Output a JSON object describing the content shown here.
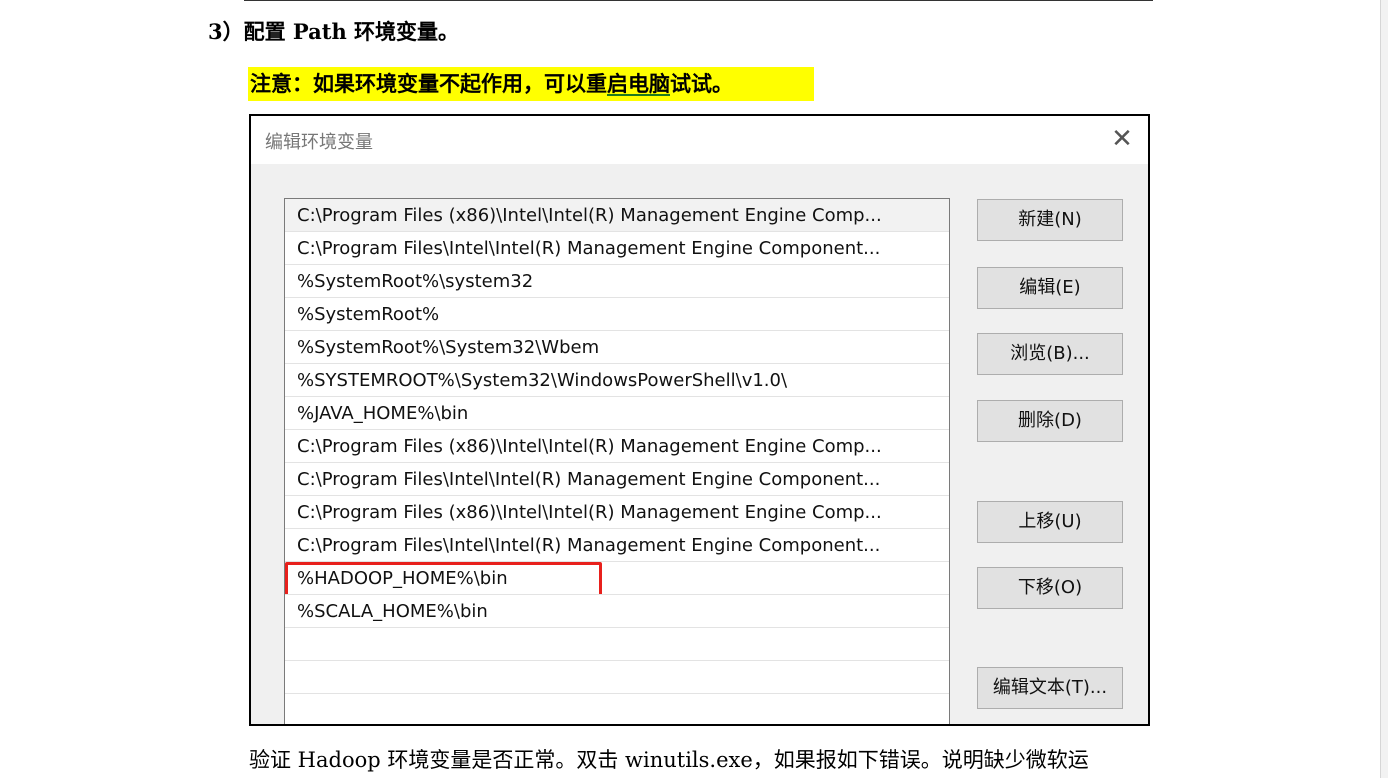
{
  "document": {
    "heading": "3）配置 Path 环境变量。",
    "note": {
      "prefix": "注意：如果环境变量不起作用，可以重",
      "underlined": "启电脑",
      "suffix": "试试。"
    },
    "paragraph": "验证 Hadoop 环境变量是否正常。双击 winutils.exe，如果报如下错误。说明缺少微软运"
  },
  "dialog": {
    "title": "编辑环境变量",
    "close_symbol": "✕",
    "entries": [
      "C:\\Program Files (x86)\\Intel\\Intel(R) Management Engine Comp...",
      "C:\\Program Files\\Intel\\Intel(R) Management Engine Component...",
      "%SystemRoot%\\system32",
      "%SystemRoot%",
      "%SystemRoot%\\System32\\Wbem",
      "%SYSTEMROOT%\\System32\\WindowsPowerShell\\v1.0\\",
      "%JAVA_HOME%\\bin",
      "C:\\Program Files (x86)\\Intel\\Intel(R) Management Engine Comp...",
      "C:\\Program Files\\Intel\\Intel(R) Management Engine Component...",
      "C:\\Program Files (x86)\\Intel\\Intel(R) Management Engine Comp...",
      "C:\\Program Files\\Intel\\Intel(R) Management Engine Component...",
      "%HADOOP_HOME%\\bin",
      "%SCALA_HOME%\\bin",
      "",
      "",
      ""
    ],
    "highlighted_entry": "%HADOOP_HOME%\\bin",
    "buttons": {
      "new": "新建(N)",
      "edit": "编辑(E)",
      "browse": "浏览(B)...",
      "delete": "删除(D)",
      "move_up": "上移(U)",
      "move_down": "下移(O)",
      "edit_text": "编辑文本(T)..."
    }
  },
  "colors": {
    "highlight_box": "#e8201c",
    "note_background": "#ffff00"
  }
}
